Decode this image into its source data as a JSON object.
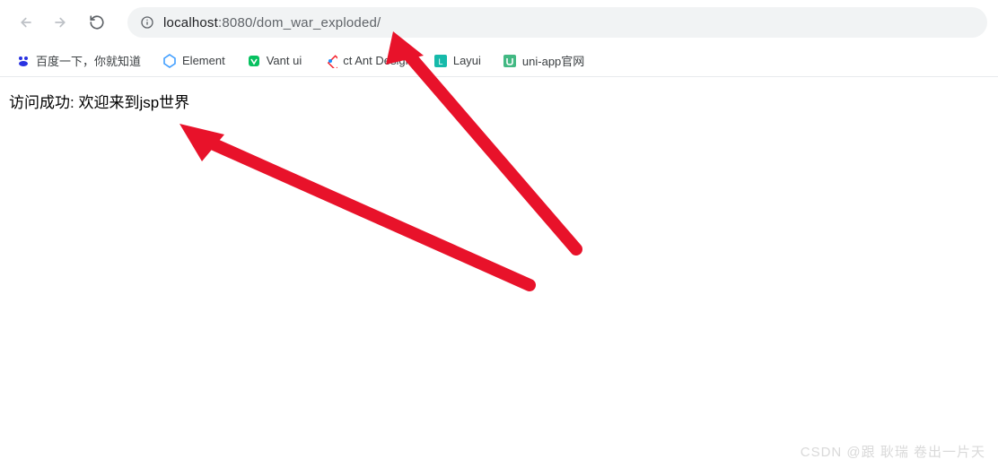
{
  "address": {
    "host": "localhost",
    "port_path": ":8080/dom_war_exploded/"
  },
  "bookmarks": [
    {
      "label": "百度一下，你就知道",
      "icon": "baidu",
      "color": "#2932e1"
    },
    {
      "label": "Element",
      "icon": "element",
      "color": "#409eff"
    },
    {
      "label": "Vant ui",
      "icon": "vant",
      "color": "#07c160"
    },
    {
      "label": "ct Ant Design",
      "icon": "antd",
      "color": "#f5222d"
    },
    {
      "label": "Layui",
      "icon": "layui",
      "color": "#16baaa"
    },
    {
      "label": "uni-app官网",
      "icon": "uniapp",
      "color": "#42b983"
    }
  ],
  "page": {
    "message": "访问成功: 欢迎来到jsp世界"
  },
  "watermark": "CSDN @跟 耿瑞 卷出一片天"
}
